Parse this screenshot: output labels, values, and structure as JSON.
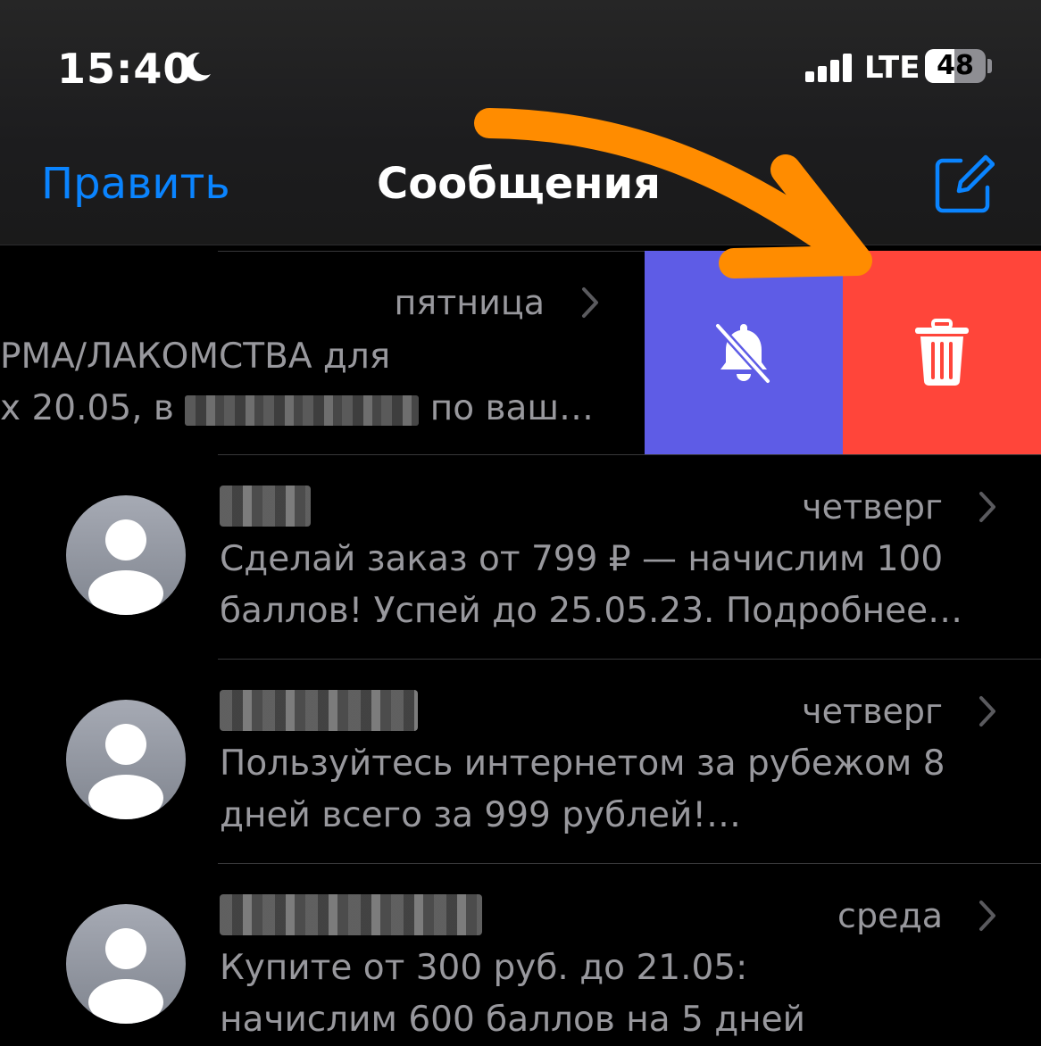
{
  "status_bar": {
    "time": "15:40",
    "network": "LTE",
    "battery_percent": "48",
    "battery_level": 0.48,
    "icons": [
      "moon-icon",
      "signal-icon",
      "battery-icon"
    ]
  },
  "nav": {
    "edit_label": "Править",
    "title": "Сообщения",
    "compose_icon": "compose-icon"
  },
  "conversations": [
    {
      "sender": "",
      "date": "пятница",
      "preview_line1": "РМА/ЛАКОМСТВА для",
      "preview_line2_start": "х 20.05, в",
      "preview_line2_end": "по ваш…",
      "swiped": true
    },
    {
      "sender": "",
      "date": "четверг",
      "preview_line1": "Сделай заказ от 799 ₽ — начислим 100",
      "preview_line2": "баллов! Успей до 25.05.23. Подробнее…"
    },
    {
      "sender": "",
      "date": "четверг",
      "preview_line1": "Пользуйтесь интернетом за рубежом 8",
      "preview_line2": "дней всего за 999 рублей!…"
    },
    {
      "sender": "",
      "date": "среда",
      "preview_line1": "Купите от 300 руб. до 21.05:",
      "preview_line2": "начислим 600 баллов на 5 дней"
    }
  ],
  "swipe_actions": {
    "mute_icon": "bell-slash-icon",
    "delete_icon": "trash-icon"
  },
  "colors": {
    "accent": "#0a84ff",
    "mute_bg": "#5e5ce6",
    "delete_bg": "#ff453a",
    "annotation_arrow": "#ff8c00"
  }
}
